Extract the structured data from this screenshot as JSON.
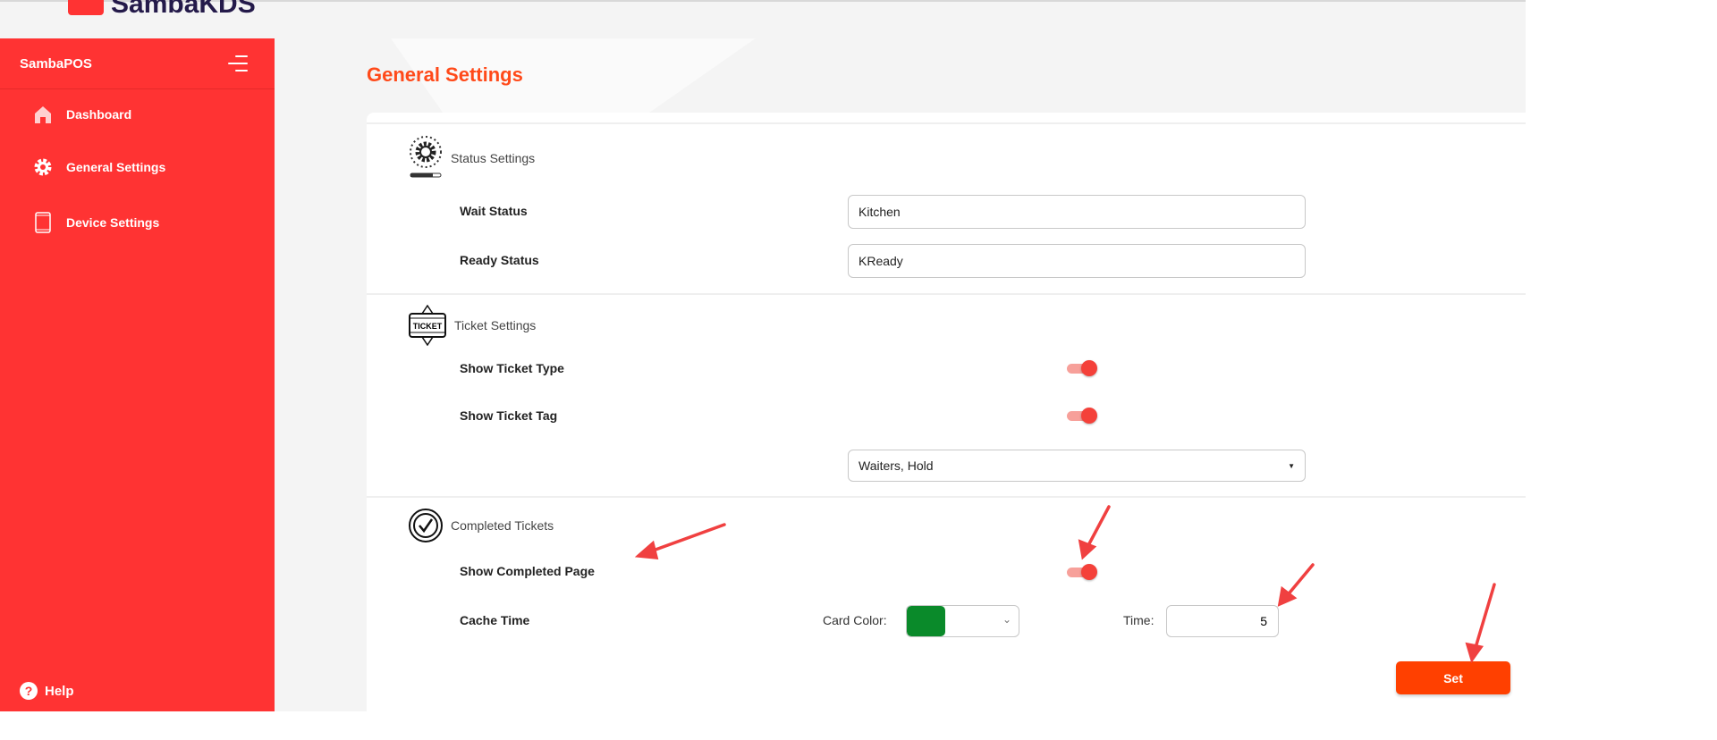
{
  "header": {
    "logo_text": "SambaKDS"
  },
  "sidebar": {
    "title": "SambaPOS",
    "items": [
      {
        "label": "Dashboard",
        "icon": "home-icon"
      },
      {
        "label": "General Settings",
        "icon": "gear-icon"
      },
      {
        "label": "Device Settings",
        "icon": "tablet-icon"
      }
    ],
    "help_label": "Help",
    "color": "#ff3333"
  },
  "page": {
    "title": "General Settings",
    "accent": "#ff4a1a"
  },
  "status_settings": {
    "heading": "Status Settings",
    "wait_label": "Wait Status",
    "wait_value": "Kitchen",
    "ready_label": "Ready Status",
    "ready_value": "KReady"
  },
  "ticket_settings": {
    "heading": "Ticket Settings",
    "icon_text": "TICKET",
    "show_type_label": "Show Ticket Type",
    "show_type_on": true,
    "show_tag_label": "Show Ticket Tag",
    "show_tag_on": true,
    "tag_select_value": "Waiters, Hold"
  },
  "completed_tickets": {
    "heading": "Completed Tickets",
    "show_page_label": "Show Completed Page",
    "show_page_on": true,
    "cache_label": "Cache Time",
    "card_color_label": "Card Color:",
    "card_color": "#0a8a2a",
    "time_label": "Time:",
    "time_value": "5"
  },
  "actions": {
    "set_label": "Set",
    "set_color": "#ff4000"
  },
  "annotation_color": "#f04040"
}
